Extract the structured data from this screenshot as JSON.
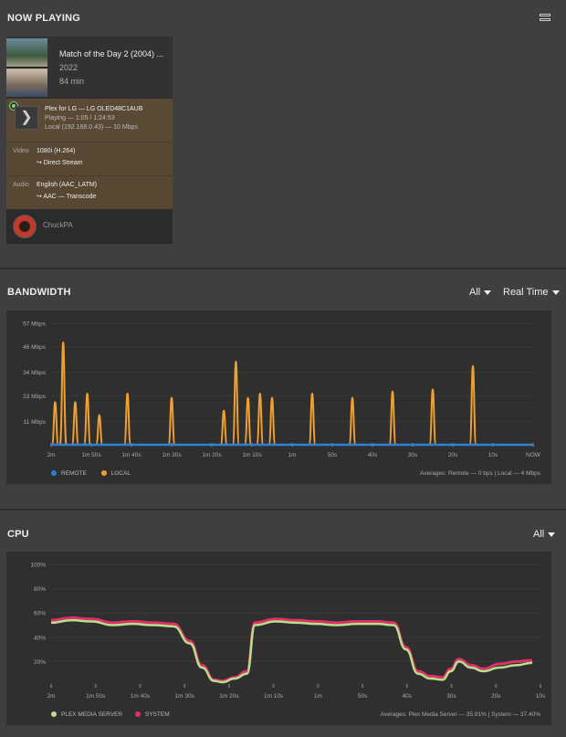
{
  "now_playing": {
    "title": "NOW PLAYING",
    "menu_icon": "list-icon",
    "item": {
      "title": "Match of the Day 2 (2004) ...",
      "year": "2022",
      "duration": "84 min"
    },
    "player": {
      "name_line": "Plex for LG  —  LG OLED48C1AUB",
      "status_line": "Playing  —  1:05 / 1:24:53",
      "network_line": "Local (192.168.0.43)  —  10 Mbps",
      "icon": "chevron-right-icon"
    },
    "video": {
      "label": "Video",
      "value": "1080i (H.264)",
      "mode": "↪  Direct Stream"
    },
    "audio": {
      "label": "Audio",
      "value": "English (AAC_LATM)",
      "mode": "↪  AAC — Transcode"
    },
    "user": {
      "name": "ChuckPA"
    }
  },
  "bandwidth": {
    "title": "BANDWIDTH",
    "filter": "All",
    "range": "Real Time",
    "legend": [
      {
        "name": "REMOTE",
        "color": "#2f7fd8"
      },
      {
        "name": "LOCAL",
        "color": "#f0a030"
      }
    ],
    "averages": "Averages: Remote — 0 bps | Local — 4 Mbps"
  },
  "cpu": {
    "title": "CPU",
    "filter": "All",
    "legend": [
      {
        "name": "PLEX MEDIA SERVER",
        "color": "#b8e08a"
      },
      {
        "name": "SYSTEM",
        "color": "#e0306a"
      }
    ],
    "averages": "Averages: Plex Media Server — 35.91% | System — 37.40%"
  },
  "chart_data": [
    {
      "type": "line",
      "title": "BANDWIDTH",
      "y_ticks": [
        "57 Mbps",
        "46 Mbps",
        "34 Mbps",
        "23 Mbps",
        "11 Mbps"
      ],
      "y_tick_values": [
        57,
        46,
        34,
        23,
        11
      ],
      "ylim": [
        0,
        57
      ],
      "x_ticks": [
        "2m",
        "1m 50s",
        "1m 40s",
        "1m 30s",
        "1m 20s",
        "1m 10s",
        "1m",
        "50s",
        "40s",
        "30s",
        "20s",
        "10s",
        "NOW"
      ],
      "xlim": [
        120,
        0
      ],
      "series": [
        {
          "name": "REMOTE",
          "color": "#2f7fd8",
          "x": [
            120,
            0
          ],
          "values": [
            0,
            0
          ]
        },
        {
          "name": "LOCAL",
          "color": "#f0a030",
          "peaks": [
            [
              119,
              20
            ],
            [
              117,
              48
            ],
            [
              114,
              20
            ],
            [
              111,
              24
            ],
            [
              108,
              14
            ],
            [
              101,
              24
            ],
            [
              90,
              22
            ],
            [
              77,
              16
            ],
            [
              74,
              39
            ],
            [
              71,
              22
            ],
            [
              68,
              24
            ],
            [
              65,
              22
            ],
            [
              55,
              24
            ],
            [
              45,
              22
            ],
            [
              35,
              25
            ],
            [
              25,
              26
            ],
            [
              15,
              37
            ]
          ]
        }
      ]
    },
    {
      "type": "line",
      "title": "CPU",
      "y_ticks": [
        "100%",
        "80%",
        "60%",
        "40%",
        "20%"
      ],
      "y_tick_values": [
        100,
        80,
        60,
        40,
        20
      ],
      "ylim": [
        0,
        100
      ],
      "x_ticks": [
        "2m",
        "1m 50s",
        "1m 40s",
        "1m 30s",
        "1m 20s",
        "1m 10s",
        "1m",
        "50s",
        "40s",
        "30s",
        "20s",
        "10s"
      ],
      "xlim": [
        120,
        0
      ],
      "series": [
        {
          "name": "PLEX MEDIA SERVER",
          "color": "#b8e08a",
          "x": [
            120,
            115,
            110,
            105,
            100,
            95,
            90,
            86,
            83,
            80,
            78,
            75,
            72,
            70,
            65,
            60,
            55,
            50,
            45,
            40,
            36,
            33,
            30,
            27,
            24,
            22,
            20,
            17,
            14,
            10,
            6,
            2
          ],
          "values": [
            52,
            54,
            53,
            50,
            51,
            50,
            49,
            35,
            15,
            4,
            3,
            6,
            10,
            50,
            53,
            52,
            51,
            50,
            51,
            51,
            50,
            30,
            10,
            6,
            5,
            12,
            20,
            15,
            12,
            15,
            17,
            19
          ]
        },
        {
          "name": "SYSTEM",
          "color": "#e0306a",
          "x": [
            120,
            115,
            110,
            105,
            100,
            95,
            90,
            86,
            83,
            80,
            78,
            75,
            72,
            70,
            65,
            60,
            55,
            50,
            45,
            40,
            36,
            33,
            30,
            27,
            24,
            22,
            20,
            17,
            14,
            10,
            6,
            2
          ],
          "values": [
            54,
            56,
            55,
            52,
            53,
            52,
            51,
            37,
            17,
            5,
            4,
            7,
            12,
            52,
            55,
            54,
            53,
            52,
            53,
            53,
            52,
            32,
            12,
            8,
            7,
            14,
            22,
            17,
            14,
            18,
            20,
            21
          ]
        }
      ]
    }
  ]
}
